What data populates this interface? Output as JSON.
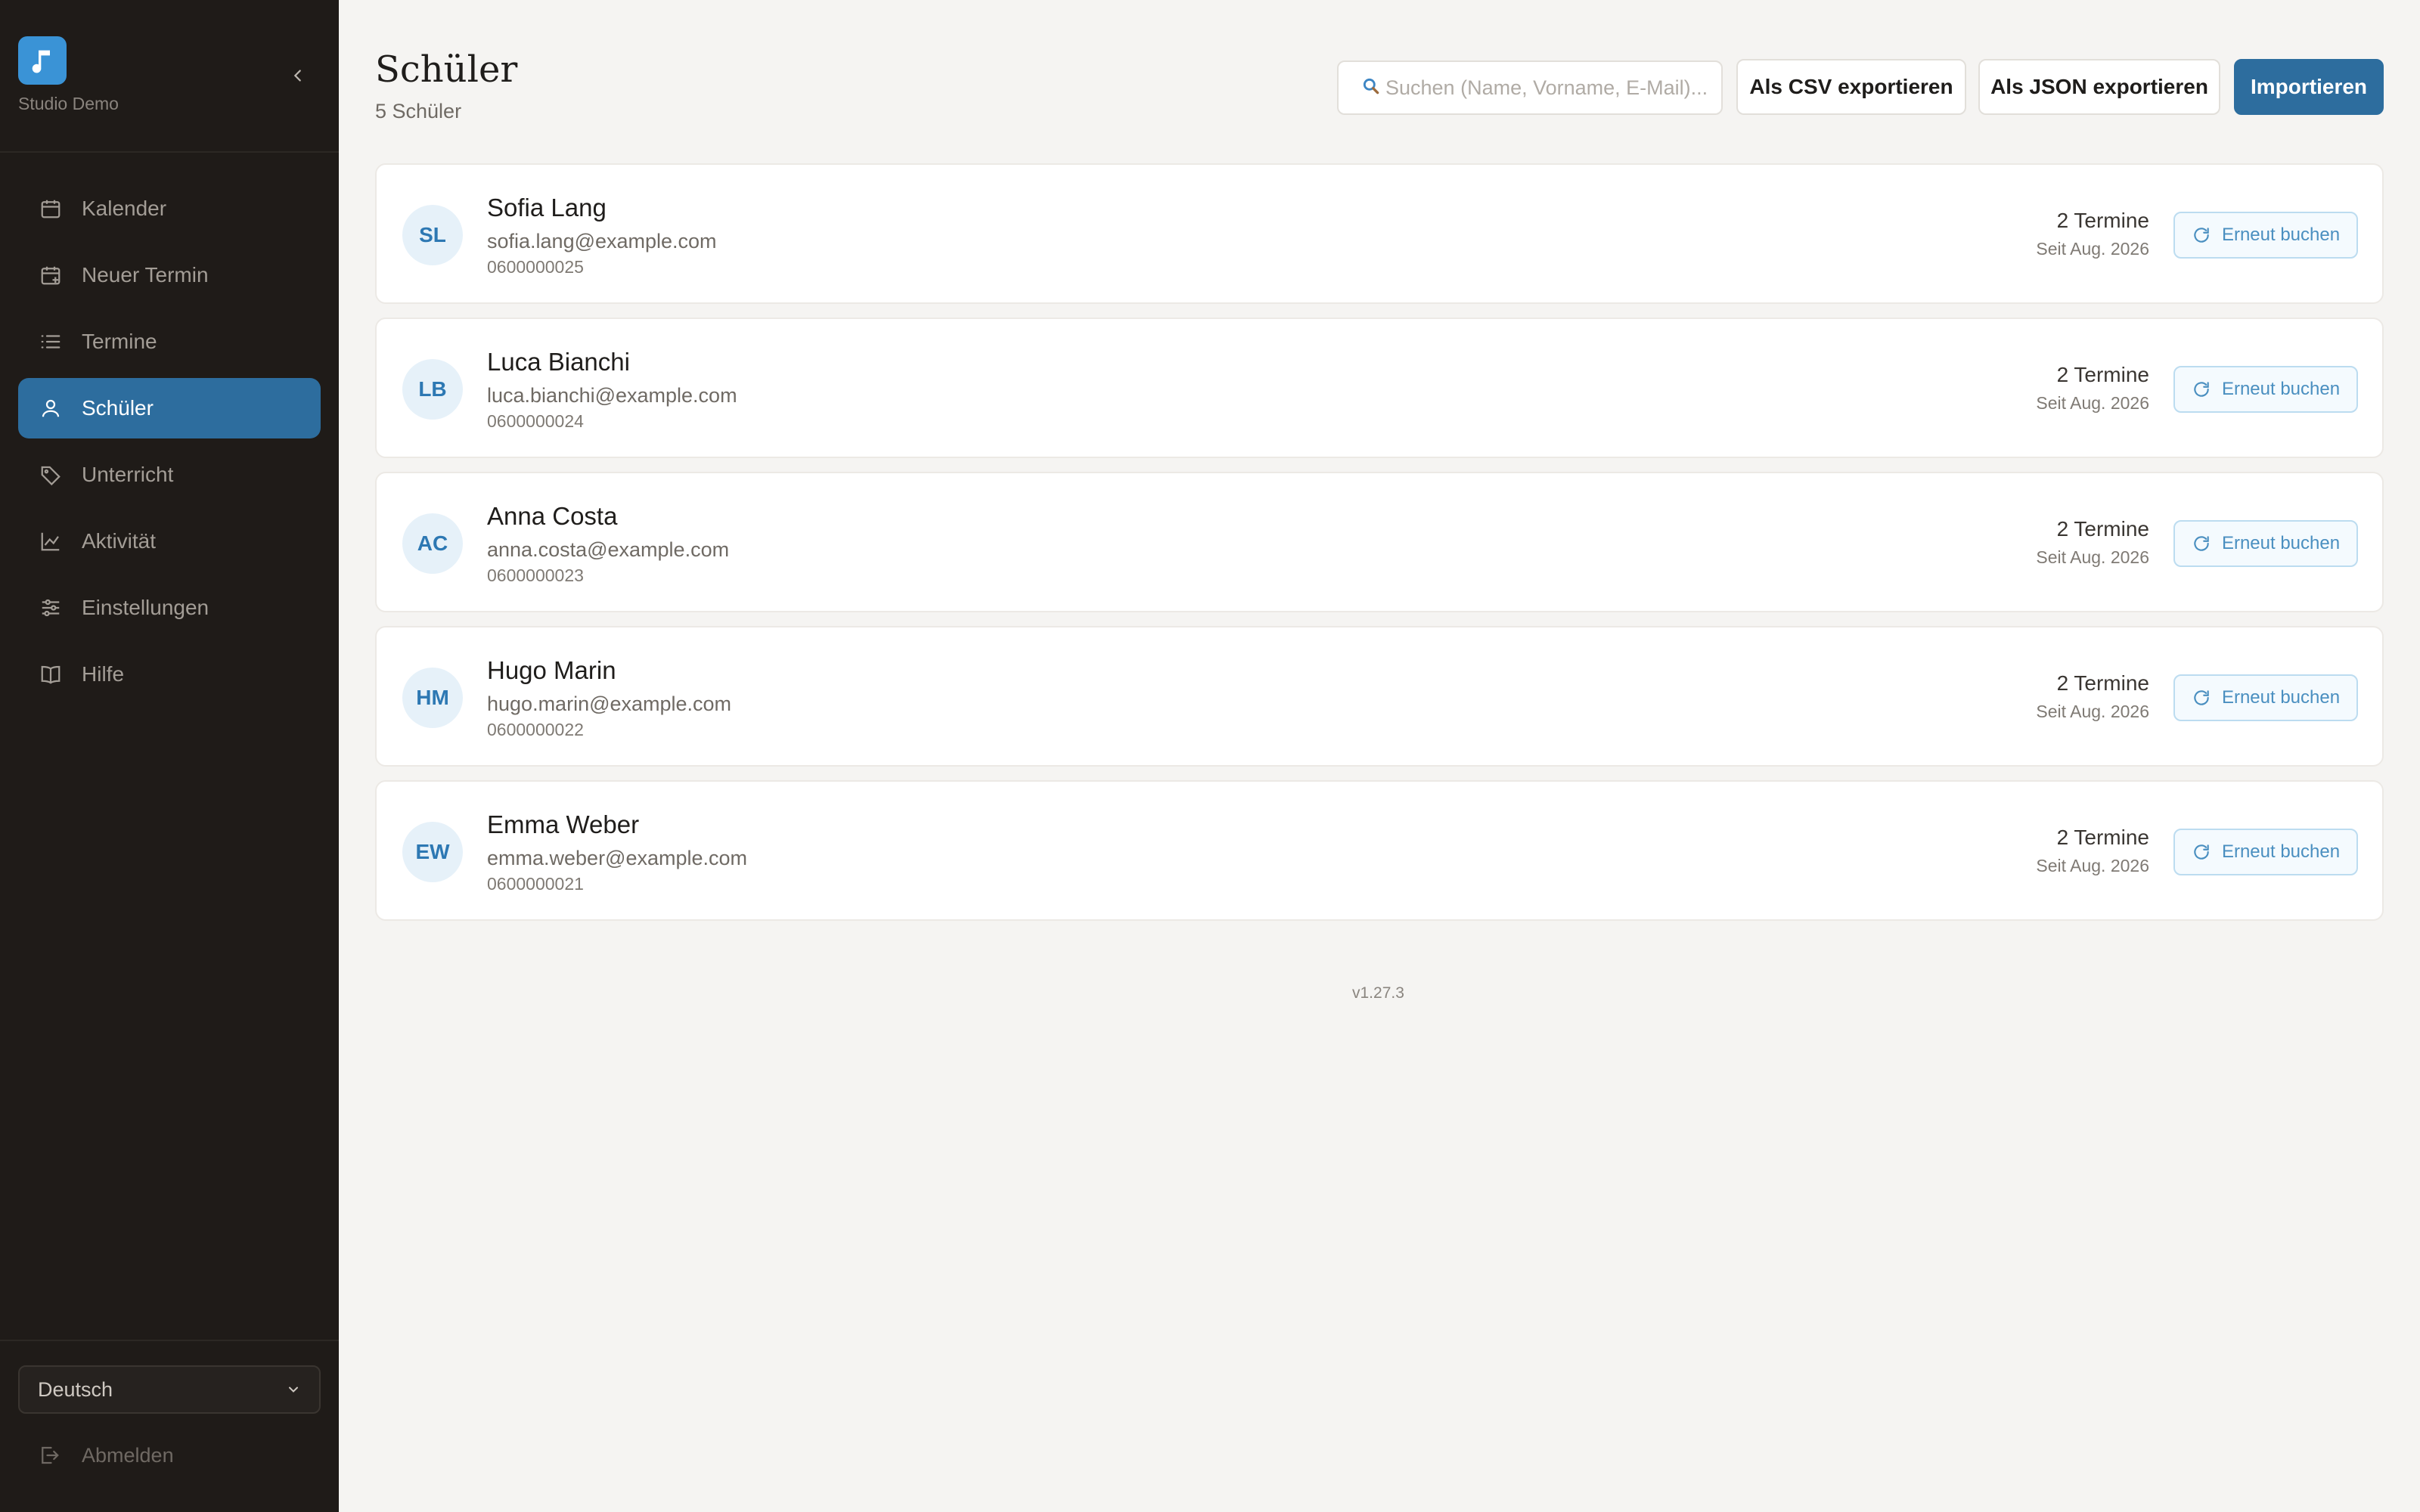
{
  "sidebar": {
    "brand_name": "Studio Demo",
    "items": [
      {
        "label": "Kalender",
        "icon": "calendar-icon",
        "active": false
      },
      {
        "label": "Neuer Termin",
        "icon": "calendar-plus-icon",
        "active": false
      },
      {
        "label": "Termine",
        "icon": "list-icon",
        "active": false
      },
      {
        "label": "Schüler",
        "icon": "user-icon",
        "active": true
      },
      {
        "label": "Unterricht",
        "icon": "tag-icon",
        "active": false
      },
      {
        "label": "Aktivität",
        "icon": "chart-line-icon",
        "active": false
      },
      {
        "label": "Einstellungen",
        "icon": "sliders-icon",
        "active": false
      },
      {
        "label": "Hilfe",
        "icon": "book-icon",
        "active": false
      }
    ],
    "language": "Deutsch",
    "logout_label": "Abmelden"
  },
  "header": {
    "title": "Schüler",
    "subtitle": "5 Schüler",
    "search_placeholder": "Suchen (Name, Vorname, E-Mail)...",
    "export_csv_label": "Als CSV exportieren",
    "export_json_label": "Als JSON exportieren",
    "import_label": "Importieren"
  },
  "students": [
    {
      "initials": "SL",
      "name": "Sofia Lang",
      "email": "sofia.lang@example.com",
      "phone": "0600000025",
      "count": "2 Termine",
      "since": "Seit Aug. 2026",
      "rebook_label": "Erneut buchen"
    },
    {
      "initials": "LB",
      "name": "Luca Bianchi",
      "email": "luca.bianchi@example.com",
      "phone": "0600000024",
      "count": "2 Termine",
      "since": "Seit Aug. 2026",
      "rebook_label": "Erneut buchen"
    },
    {
      "initials": "AC",
      "name": "Anna Costa",
      "email": "anna.costa@example.com",
      "phone": "0600000023",
      "count": "2 Termine",
      "since": "Seit Aug. 2026",
      "rebook_label": "Erneut buchen"
    },
    {
      "initials": "HM",
      "name": "Hugo Marin",
      "email": "hugo.marin@example.com",
      "phone": "0600000022",
      "count": "2 Termine",
      "since": "Seit Aug. 2026",
      "rebook_label": "Erneut buchen"
    },
    {
      "initials": "EW",
      "name": "Emma Weber",
      "email": "emma.weber@example.com",
      "phone": "0600000021",
      "count": "2 Termine",
      "since": "Seit Aug. 2026",
      "rebook_label": "Erneut buchen"
    }
  ],
  "footer": {
    "version": "v1.27.3"
  },
  "colors": {
    "accent": "#2d6d9e",
    "sidebar_bg": "#1f1b18",
    "page_bg": "#f5f4f2",
    "avatar_bg": "#e6f1f9",
    "avatar_text": "#2d78b3"
  }
}
